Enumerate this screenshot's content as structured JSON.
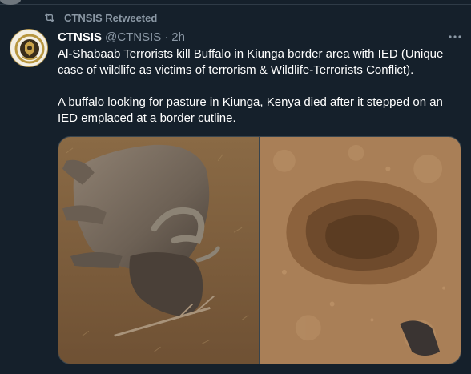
{
  "retweet": {
    "label": "CTNSIS Retweeted",
    "icon": "retweet-icon"
  },
  "tweet": {
    "author_name": "CTNSIS",
    "author_handle": "@CTNSIS",
    "separator": "·",
    "time": "2h",
    "more_icon": "more-icon",
    "paragraphs": [
      "Al-Shabāab Terrorists kill Buffalo in Kiunga border area with IED (Unique case of wildlife as victims of terrorism & Wildlife-Terrorists Conflict).",
      "A buffalo looking for pasture in Kiunga, Kenya died after it stepped on an IED emplaced at a border cutline."
    ]
  },
  "colors": {
    "background": "#15202b",
    "muted": "#8b98a5",
    "text": "#ffffff"
  }
}
